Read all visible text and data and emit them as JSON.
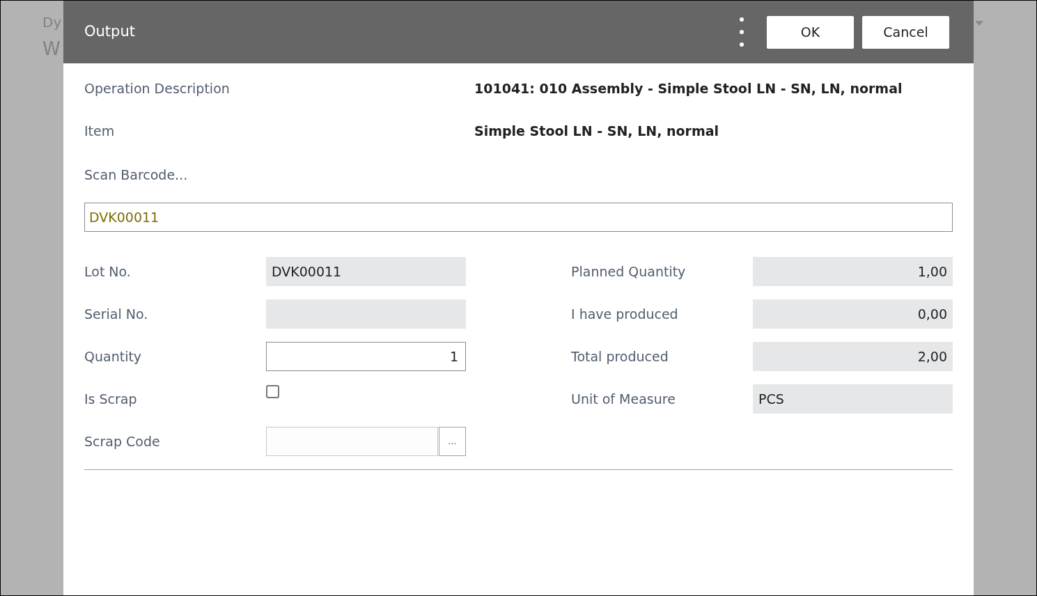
{
  "background_page": {
    "title_fragment": "Dy",
    "heading_fragment": "W"
  },
  "dialog": {
    "title": "Output",
    "buttons": [
      {
        "label": "OK"
      },
      {
        "label": "Cancel"
      }
    ],
    "info": [
      {
        "label": "Operation Description",
        "value": "101041: 010 Assembly - Simple Stool LN - SN, LN, normal"
      },
      {
        "label": "Item",
        "value": "Simple Stool LN - SN, LN, normal"
      }
    ],
    "barcode": {
      "label": "Scan Barcode...",
      "value": "DVK00011"
    },
    "left_fields": [
      {
        "kind": "text",
        "label": "Lot No.",
        "value": "DVK00011"
      },
      {
        "kind": "text",
        "label": "Serial No."
      },
      {
        "kind": "input",
        "label": "Quantity",
        "value": "1"
      },
      {
        "kind": "checkbox",
        "label": "Is Scrap",
        "checked": false
      },
      {
        "kind": "lookup",
        "label": "Scrap Code",
        "button": "..."
      }
    ],
    "right_fields": [
      {
        "kind": "number",
        "label": "Planned Quantity",
        "value": "1,00"
      },
      {
        "kind": "number",
        "label": "I have produced",
        "value": "0,00"
      },
      {
        "kind": "number",
        "label": "Total produced",
        "value": "2,00"
      },
      {
        "kind": "text",
        "label": "Unit of Measure",
        "value": "PCS"
      }
    ]
  }
}
